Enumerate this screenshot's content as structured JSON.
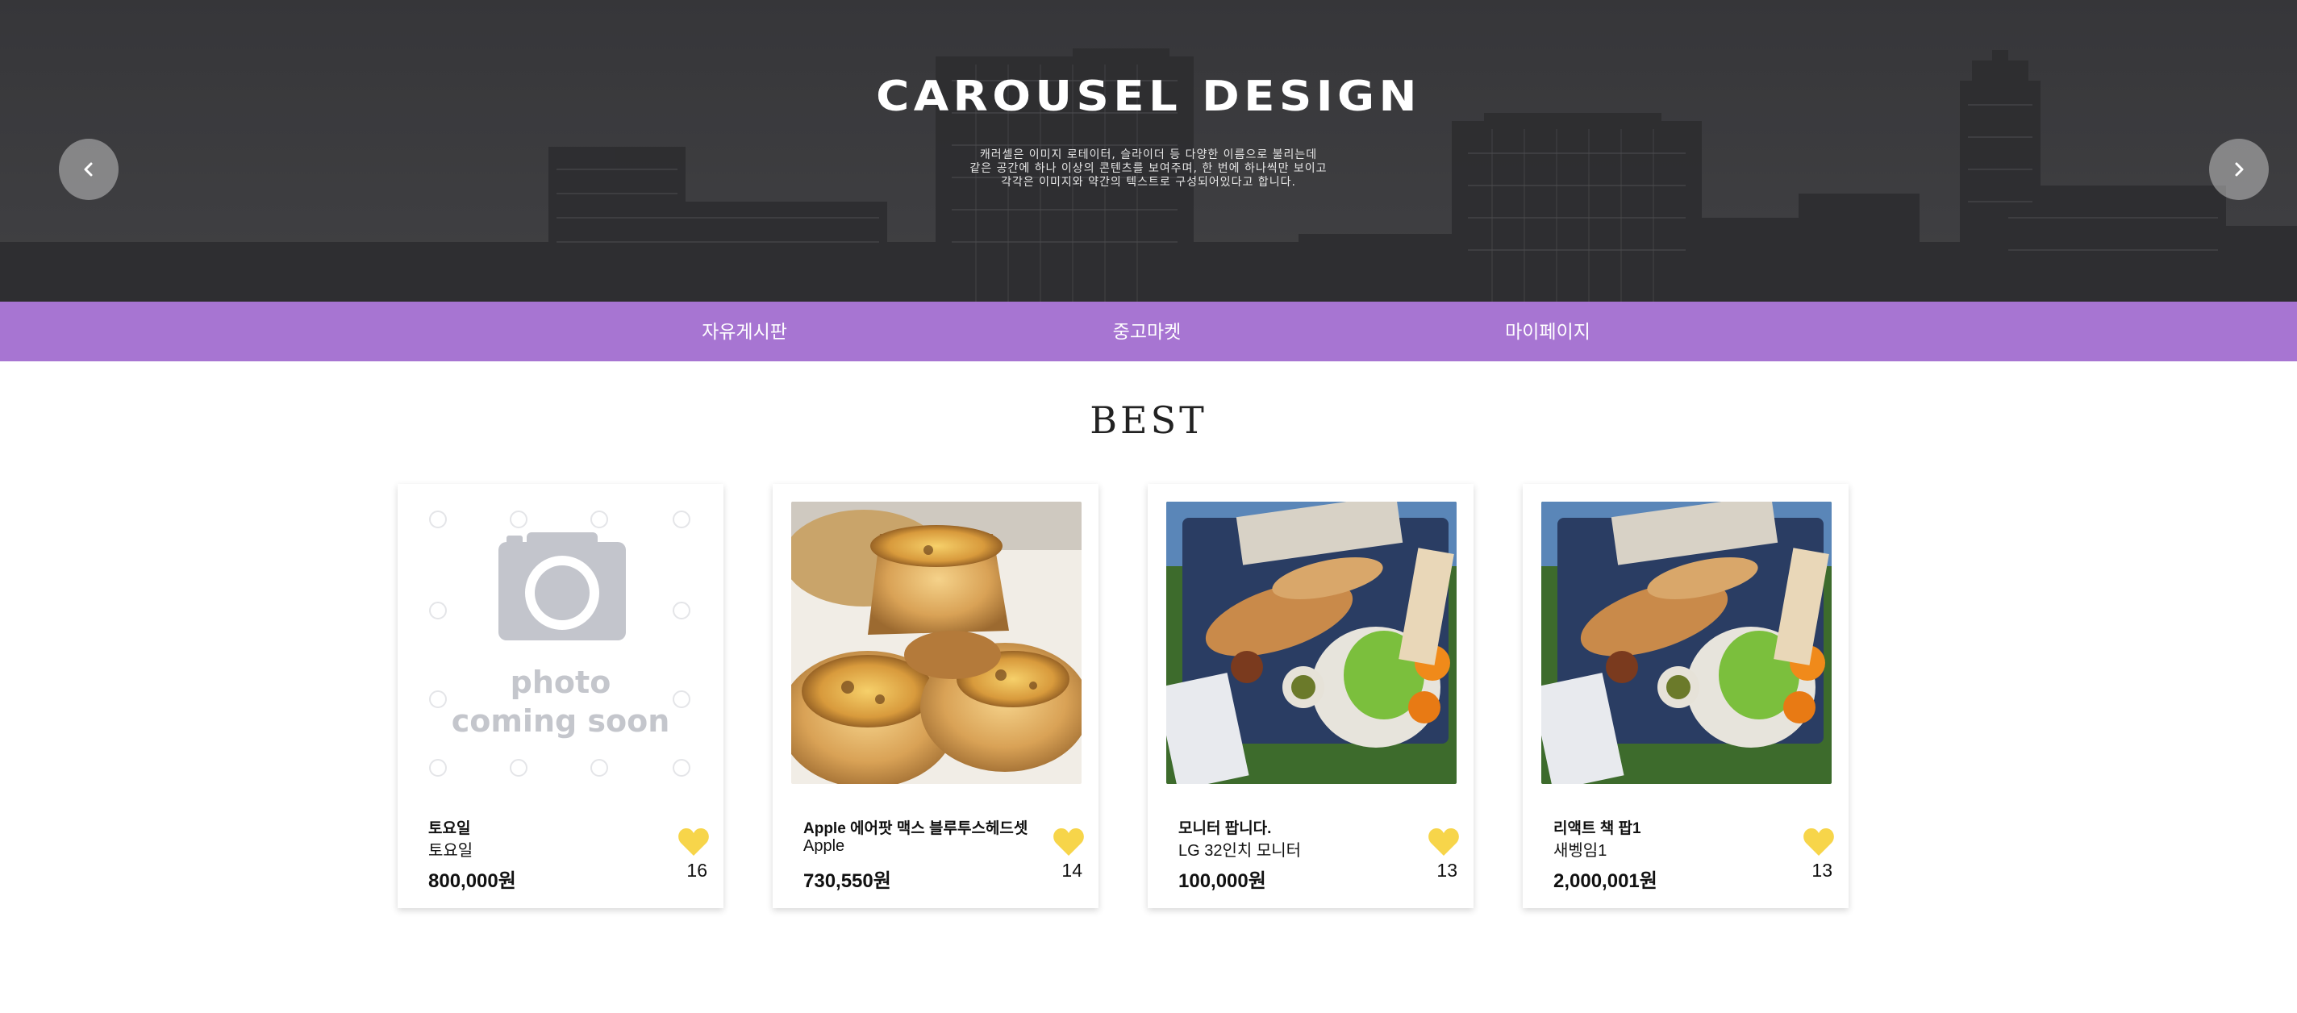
{
  "hero": {
    "title": "CAROUSEL DESIGN",
    "description": [
      "캐러셀은 이미지 로테이터, 슬라이더 등 다양한 이름으로 불리는데",
      "같은 공간에 하나 이상의 콘텐츠를 보여주며, 한 번에 하나씩만 보이고",
      "각각은 이미지와 약간의 텍스트로 구성되어있다고 합니다."
    ],
    "prev_icon": "chevron-left-icon",
    "prev_label": "‹",
    "next_icon": "chevron-right-icon",
    "next_label": "›"
  },
  "nav": {
    "items": [
      {
        "label": "자유게시판"
      },
      {
        "label": "중고마켓"
      },
      {
        "label": "마이페이지"
      }
    ],
    "color": "#a775d2"
  },
  "best": {
    "title": "BEST",
    "heart_color": "#f7d54a",
    "cards": [
      {
        "title": "토요일",
        "subtitle": "토요일",
        "price": "800,000원",
        "likes": "16",
        "image": "photo-coming-soon",
        "placeholder_line1": "photo",
        "placeholder_line2": "coming soon"
      },
      {
        "title": "Apple 에어팟 맥스 블루투스헤드셋",
        "subtitle": "Apple",
        "price": "730,550원",
        "likes": "14",
        "image": "egg-tarts-photo"
      },
      {
        "title": "모니터 팝니다.",
        "subtitle": "LG 32인치 모니터",
        "price": "100,000원",
        "likes": "13",
        "image": "picnic-box-photo"
      },
      {
        "title": "리액트 책 팝1",
        "subtitle": "새벵임1",
        "price": "2,000,001원",
        "likes": "13",
        "image": "picnic-box-photo"
      }
    ]
  }
}
